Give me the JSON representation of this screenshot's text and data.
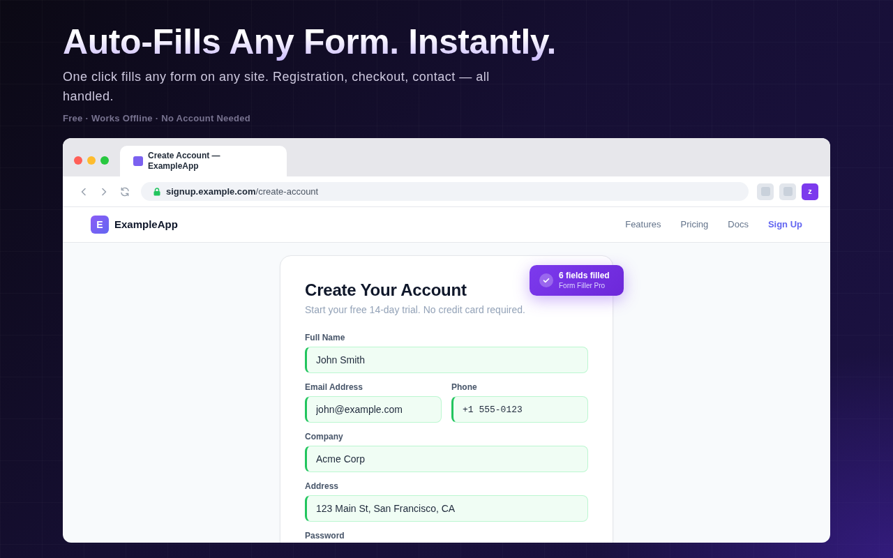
{
  "hero": {
    "headline": "Auto-Fills Any Form. Instantly.",
    "subtitle": "One click fills any form on any site. Registration, checkout, contact — all handled.",
    "tagline": "Free · Works Offline · No Account Needed"
  },
  "browser": {
    "tab": {
      "title": "Create Account — ExampleApp",
      "selected": true
    },
    "url": {
      "host": "signup.example.com",
      "path": "/create-account",
      "secure": true
    },
    "extensions": [
      {
        "kind": "blank"
      },
      {
        "kind": "blank"
      },
      {
        "kind": "app",
        "label": "z"
      }
    ]
  },
  "site": {
    "brand": {
      "letter": "E",
      "name": "ExampleApp"
    },
    "nav": [
      {
        "label": "Features",
        "kind": "link"
      },
      {
        "label": "Pricing",
        "kind": "link"
      },
      {
        "label": "Docs",
        "kind": "link"
      },
      {
        "label": "Sign Up",
        "kind": "cta"
      }
    ]
  },
  "form": {
    "title": "Create Your Account",
    "subtitle": "Start your free 14-day trial. No credit card required.",
    "rows": [
      [
        {
          "label": "Full Name",
          "value": "John Smith",
          "kind": "text",
          "filled": true
        }
      ],
      [
        {
          "label": "Email Address",
          "value": "john@example.com",
          "kind": "email",
          "filled": true
        },
        {
          "label": "Phone",
          "value": "+1 555-0123",
          "kind": "phone",
          "filled": true
        }
      ],
      [
        {
          "label": "Company",
          "value": "Acme Corp",
          "kind": "text",
          "filled": true
        }
      ],
      [
        {
          "label": "Address",
          "value": "123 Main St, San Francisco, CA",
          "kind": "text",
          "filled": true
        }
      ],
      [
        {
          "label": "Password"
        }
      ]
    ]
  },
  "badge": {
    "title": "6 fields filled",
    "subtitle": "Form Filler Pro"
  }
}
